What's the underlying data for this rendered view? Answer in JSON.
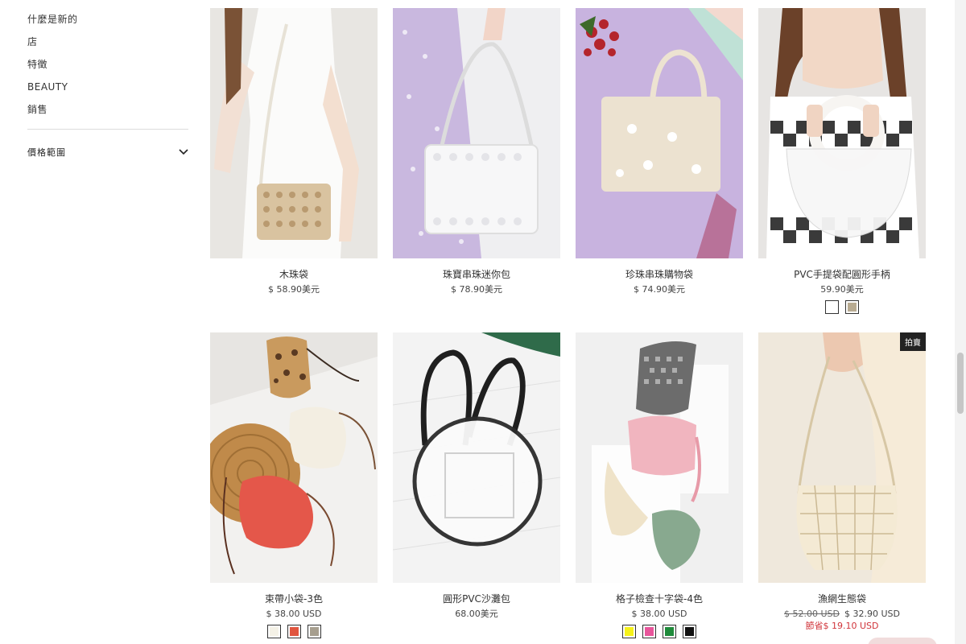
{
  "sidebar": {
    "nav": [
      "什麼是新的",
      "店",
      "特徵",
      "BEAUTY",
      "銷售"
    ],
    "filter_label": "價格範圍"
  },
  "products": [
    {
      "name": "木珠袋",
      "price": "$ 58.90美元"
    },
    {
      "name": "珠寶串珠迷你包",
      "price": "$ 78.90美元"
    },
    {
      "name": "珍珠串珠購物袋",
      "price": "$ 74.90美元"
    },
    {
      "name": "PVC手提袋配圓形手柄",
      "price": "59.90美元",
      "swatches": [
        "#ffffff",
        "#b8ab91"
      ]
    },
    {
      "name": "束帶小袋-3色",
      "price": "$ 38.00 USD",
      "swatches": [
        "#f4f1e6",
        "#e0553f",
        "#a79f8f"
      ]
    },
    {
      "name": "圓形PVC沙灘包",
      "price": "68.00美元"
    },
    {
      "name": "格子檢查十字袋-4色",
      "price": "$ 38.00 USD",
      "swatches": [
        "#f6f21a",
        "#e8559b",
        "#1f8a3a",
        "#111111"
      ]
    },
    {
      "name": "漁網生態袋",
      "price_old": "$ 52.00 USD",
      "price": "$ 32.90 USD",
      "savings": "節省$ 19.10 USD",
      "badge": "拍賣"
    }
  ],
  "colors": {
    "sale": "#d0343a",
    "badge_bg": "#222222"
  }
}
